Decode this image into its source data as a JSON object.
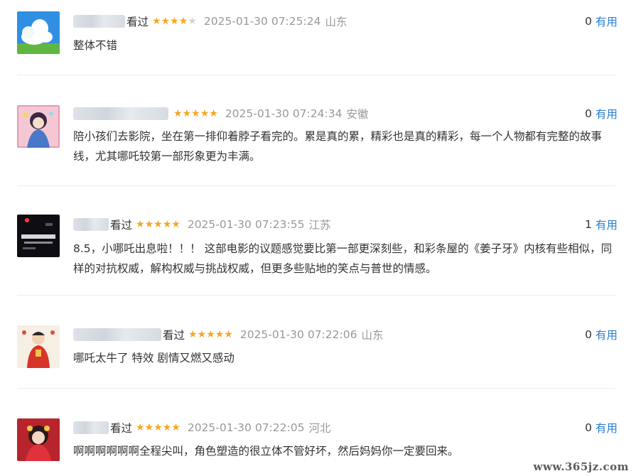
{
  "reviews": [
    {
      "seen_label": "看过",
      "rating": 4,
      "time": "2025-01-30 07:25:24",
      "region": "山东",
      "useful_count": "0",
      "useful_label": "有用",
      "content": "整体不错",
      "avatar_icon": "cloud-sky-icon"
    },
    {
      "seen_label": "",
      "rating": 5,
      "time": "2025-01-30 07:24:34",
      "region": "安徽",
      "useful_count": "0",
      "useful_label": "有用",
      "content": "陪小孩们去影院，坐在第一排仰着脖子看完的。累是真的累，精彩也是真的精彩，每一个人物都有完整的故事线，尤其哪吒较第一部形象更为丰满。",
      "avatar_icon": "anime-girl-icon"
    },
    {
      "seen_label": "看过",
      "rating": 5,
      "time": "2025-01-30 07:23:55",
      "region": "江苏",
      "useful_count": "1",
      "useful_label": "有用",
      "content": "8.5，小哪吒出息啦！！！ 这部电影的议题感觉要比第一部更深刻些，和彩条屋的《姜子牙》内核有些相似，同样的对抗权威，解构权威与挑战权威，但更多些贴地的笑点与普世的情感。",
      "avatar_icon": "night-city-icon"
    },
    {
      "seen_label": "看过",
      "rating": 5,
      "time": "2025-01-30 07:22:06",
      "region": "山东",
      "useful_count": "0",
      "useful_label": "有用",
      "content": "哪吒太牛了 特效 剧情又燃又感动",
      "avatar_icon": "new-year-figure-icon"
    },
    {
      "seen_label": "看过",
      "rating": 5,
      "time": "2025-01-30 07:22:05",
      "region": "河北",
      "useful_count": "0",
      "useful_label": "有用",
      "content": "啊啊啊啊啊啊全程尖叫，角色塑造的很立体不管好坏，然后妈妈你一定要回来。",
      "avatar_icon": "girl-red-dress-icon"
    }
  ],
  "watermark": "www.365jz.com",
  "colors": {
    "star": "#f5a623",
    "star_off": "#d3d3d3",
    "useful": "#2d7fd1",
    "meta_gray": "#999999"
  }
}
